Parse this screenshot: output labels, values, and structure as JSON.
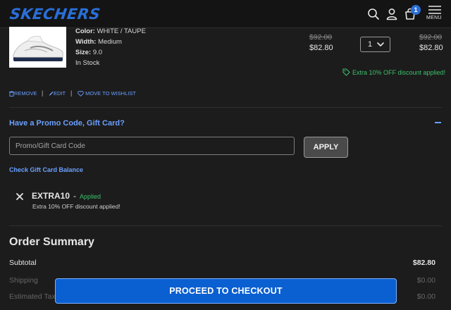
{
  "header": {
    "logo": "SKECHERS",
    "cart_count": "1",
    "menu_label": "MENU"
  },
  "product": {
    "color_label": "Color:",
    "color_value": "WHITE / TAUPE",
    "width_label": "Width:",
    "width_value": "Medium",
    "size_label": "Size:",
    "size_value": "9.0",
    "stock": "In Stock",
    "unit_price_original": "$92.00",
    "unit_price_sale": "$82.80",
    "quantity": "1",
    "total_original": "$92.00",
    "total_sale": "$82.80",
    "discount_note": "Extra 10% OFF discount applied!"
  },
  "item_actions": {
    "remove": "REMOVE",
    "edit": "EDIT",
    "wishlist": "MOVE TO WISHLIST"
  },
  "promo": {
    "title": "Have a Promo Code, Gift Card?",
    "placeholder": "Promo/Gift Card Code",
    "apply": "APPLY",
    "gift_card_balance": "Check Gift Card Balance",
    "applied_code": "EXTRA10",
    "applied_dash": "-",
    "applied_status": "Applied",
    "applied_message": "Extra 10% OFF discount applied!"
  },
  "order_summary": {
    "title": "Order Summary",
    "subtotal_label": "Subtotal",
    "subtotal_value": "$82.80",
    "shipping_label": "Shipping",
    "shipping_value": "$0.00",
    "tax_label": "Estimated Tax",
    "tax_value": "$0.00"
  },
  "checkout": {
    "label": "PROCEED TO CHECKOUT"
  },
  "colors": {
    "brand": "#2a6fd9",
    "link": "#6aa0ff",
    "success": "#3cc06a",
    "checkout": "#0a5fd1"
  }
}
